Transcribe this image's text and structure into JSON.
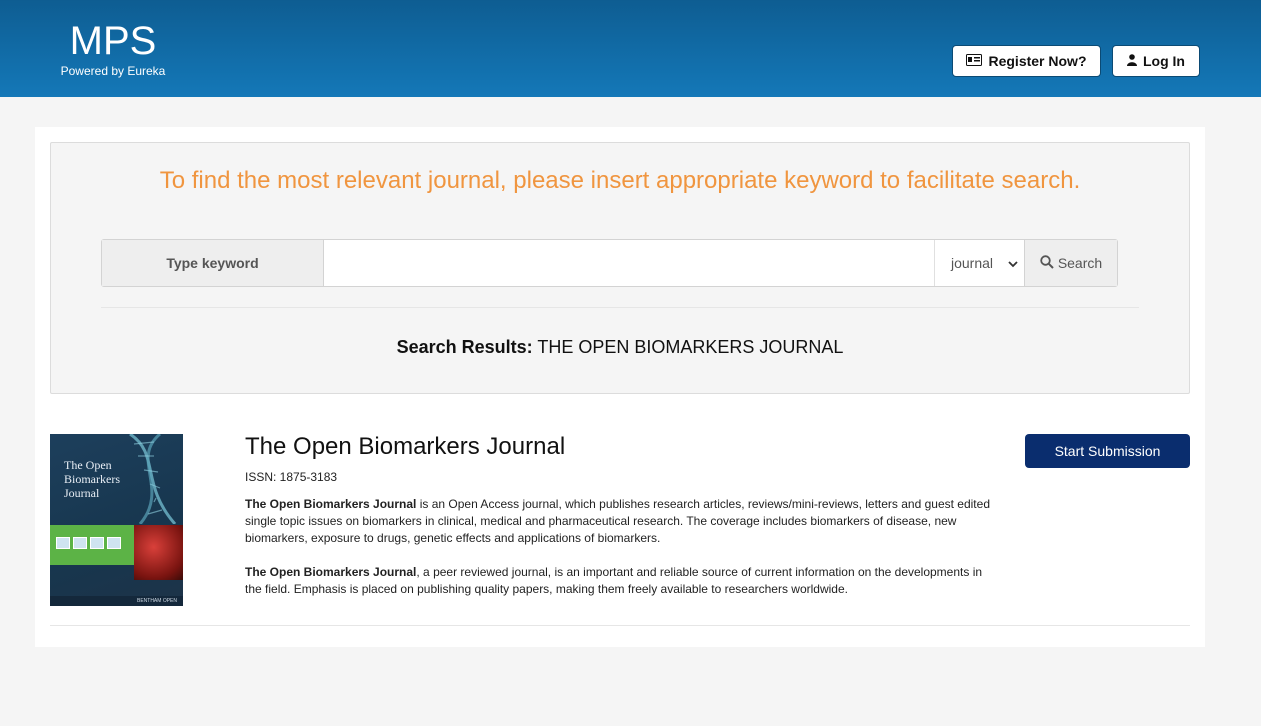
{
  "header": {
    "logo": "MPS",
    "powered_by": "Powered by Eureka",
    "register_label": "Register Now?",
    "login_label": "Log In"
  },
  "search_panel": {
    "prompt": "To find the most relevant journal, please insert appropriate keyword to facilitate search.",
    "keyword_label": "Type keyword",
    "input_value": "",
    "select_value": "journal",
    "search_button_label": "Search",
    "results_label": "Search Results:",
    "results_query": "THE OPEN BIOMARKERS JOURNAL"
  },
  "journal": {
    "cover_title_lines": [
      "The Open",
      "Biomarkers",
      "Journal"
    ],
    "cover_footer": "BENTHAM OPEN",
    "title": "The Open Biomarkers Journal",
    "issn": "ISSN: 1875-3183",
    "desc1_bold": "The Open Biomarkers Journal",
    "desc1_text": " is an Open Access journal, which publishes research articles, reviews/mini-reviews, letters and guest edited single topic issues on biomarkers in clinical, medical and pharmaceutical research. The coverage includes biomarkers of disease, new biomarkers, exposure to drugs, genetic effects and applications of biomarkers.",
    "desc2_bold": "The Open Biomarkers Journal",
    "desc2_text": ", a peer reviewed journal, is an important and reliable source of current information on the developments in the field. Emphasis is placed on publishing quality papers, making them freely available to researchers worldwide.",
    "submit_label": "Start Submission"
  },
  "colors": {
    "header_bg": "#1478b8",
    "prompt": "#f0953f",
    "submit_bg": "#0a2d6e"
  },
  "icons": {
    "register": "id-card-icon",
    "login": "user-icon",
    "search": "search-icon",
    "select": "chevron-down-icon"
  }
}
